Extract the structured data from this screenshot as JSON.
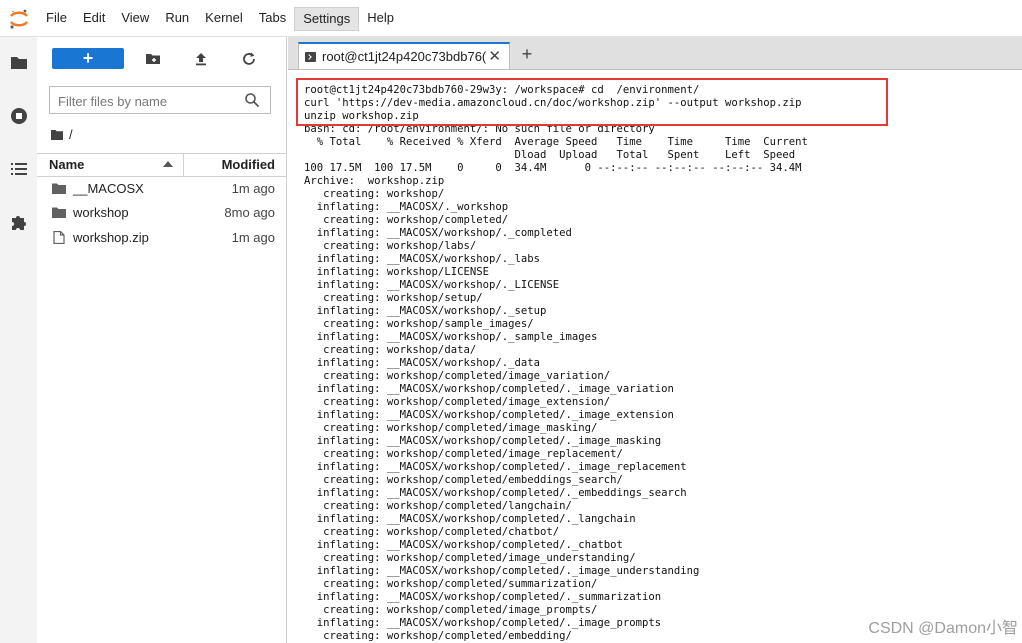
{
  "menu": {
    "items": [
      "File",
      "Edit",
      "View",
      "Run",
      "Kernel",
      "Tabs",
      "Settings",
      "Help"
    ],
    "active": "Settings"
  },
  "colors": {
    "accent": "#1976d2",
    "highlight": "#e53935"
  },
  "file_panel": {
    "new_button_label": "+",
    "filter_placeholder": "Filter files by name",
    "breadcrumb": "/",
    "columns": {
      "name": "Name",
      "modified": "Modified"
    },
    "files": [
      {
        "name": "__MACOSX",
        "modified": "1m ago",
        "icon": "folder-icon"
      },
      {
        "name": "workshop",
        "modified": "8mo ago",
        "icon": "folder-icon"
      },
      {
        "name": "workshop.zip",
        "modified": "1m ago",
        "icon": "file-icon"
      }
    ]
  },
  "tab": {
    "label": "root@ct1jt24p420c73bdb76(",
    "close": "✕",
    "add": "+"
  },
  "terminal": {
    "lines": [
      "root@ct1jt24p420c73bdb760-29w3y: /workspace# cd  /environment/",
      "curl 'https://dev-media.amazoncloud.cn/doc/workshop.zip' --output workshop.zip",
      "unzip workshop.zip",
      "bash: cd: /root/environment/: No such file or directory",
      "  % Total    % Received % Xferd  Average Speed   Time    Time     Time  Current",
      "                                 Dload  Upload   Total   Spent    Left  Speed",
      "100 17.5M  100 17.5M    0     0  34.4M      0 --:--:-- --:--:-- --:--:-- 34.4M",
      "Archive:  workshop.zip",
      "   creating: workshop/",
      "  inflating: __MACOSX/._workshop",
      "   creating: workshop/completed/",
      "  inflating: __MACOSX/workshop/._completed",
      "   creating: workshop/labs/",
      "  inflating: __MACOSX/workshop/._labs",
      "  inflating: workshop/LICENSE",
      "  inflating: __MACOSX/workshop/._LICENSE",
      "   creating: workshop/setup/",
      "  inflating: __MACOSX/workshop/._setup",
      "   creating: workshop/sample_images/",
      "  inflating: __MACOSX/workshop/._sample_images",
      "   creating: workshop/data/",
      "  inflating: __MACOSX/workshop/._data",
      "   creating: workshop/completed/image_variation/",
      "  inflating: __MACOSX/workshop/completed/._image_variation",
      "   creating: workshop/completed/image_extension/",
      "  inflating: __MACOSX/workshop/completed/._image_extension",
      "   creating: workshop/completed/image_masking/",
      "  inflating: __MACOSX/workshop/completed/._image_masking",
      "   creating: workshop/completed/image_replacement/",
      "  inflating: __MACOSX/workshop/completed/._image_replacement",
      "   creating: workshop/completed/embeddings_search/",
      "  inflating: __MACOSX/workshop/completed/._embeddings_search",
      "   creating: workshop/completed/langchain/",
      "  inflating: __MACOSX/workshop/completed/._langchain",
      "   creating: workshop/completed/chatbot/",
      "  inflating: __MACOSX/workshop/completed/._chatbot",
      "   creating: workshop/completed/image_understanding/",
      "  inflating: __MACOSX/workshop/completed/._image_understanding",
      "   creating: workshop/completed/summarization/",
      "  inflating: __MACOSX/workshop/completed/._summarization",
      "   creating: workshop/completed/image_prompts/",
      "  inflating: __MACOSX/workshop/completed/._image_prompts",
      "   creating: workshop/completed/embedding/"
    ]
  },
  "watermark": "CSDN @Damon小智"
}
